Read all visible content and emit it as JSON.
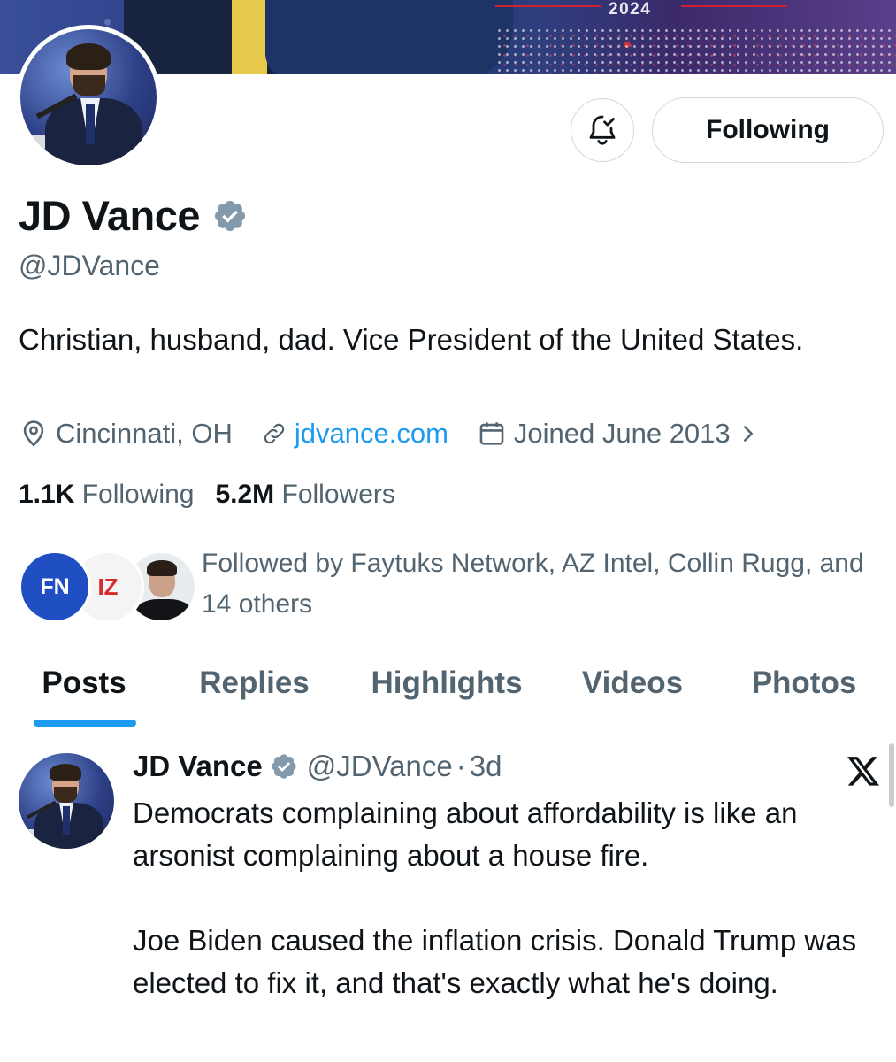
{
  "banner": {
    "year_text": "2024"
  },
  "profile": {
    "display_name": "JD Vance",
    "handle": "@JDVance",
    "bio": "Christian, husband, dad. Vice President of the United States.",
    "location": "Cincinnati, OH",
    "website": "jdvance.com",
    "joined": "Joined June 2013",
    "following_count": "1.1K",
    "following_label": "Following",
    "followers_count": "5.2M",
    "followers_label": "Followers",
    "followed_by": "Followed by Faytuks Network, AZ Intel, Collin Rugg, and 14 others",
    "follow_button_label": "Following",
    "verified": true
  },
  "mini_avatars": [
    {
      "label": "FN",
      "name": "Faytuks Network"
    },
    {
      "label": "IZ",
      "name": "AZ Intel"
    },
    {
      "label": "",
      "name": "Collin Rugg"
    }
  ],
  "tabs": [
    {
      "label": "Posts",
      "active": true
    },
    {
      "label": "Replies",
      "active": false
    },
    {
      "label": "Highlights",
      "active": false
    },
    {
      "label": "Videos",
      "active": false
    },
    {
      "label": "Photos",
      "active": false
    }
  ],
  "post": {
    "author": "JD Vance",
    "handle": "@JDVance",
    "separator": "·",
    "time": "3d",
    "text": "Democrats complaining about affordability is like an arsonist complaining about a house fire.\n\nJoe Biden caused the inflation crisis. Donald Trump was elected to fix it, and that's exactly what he's doing."
  },
  "icons": {
    "notification": "bell-check-icon",
    "location": "map-pin-icon",
    "website": "link-icon",
    "joined": "calendar-icon",
    "verified": "verified-badge-icon",
    "source": "x-logo-icon"
  },
  "colors": {
    "accent": "#1d9bf0",
    "secondary_text": "#536471",
    "primary_text": "#0f1419",
    "verified_badge": "#829aab"
  }
}
